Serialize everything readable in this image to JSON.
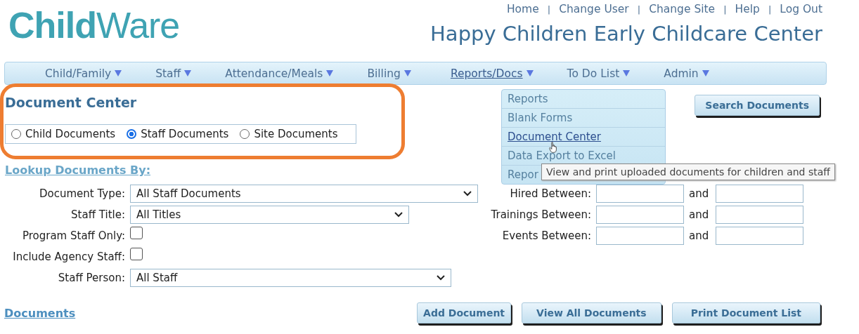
{
  "header": {
    "logo": "**Child**Ware",
    "links": [
      {
        "kind": "link",
        "label": "Home"
      },
      {
        "kind": "separator",
        "label": "|"
      },
      {
        "kind": "link",
        "label": "Change User"
      },
      {
        "kind": "separator",
        "label": "|"
      },
      {
        "kind": "link",
        "label": "Change Site"
      },
      {
        "kind": "separator",
        "label": "|"
      },
      {
        "kind": "link",
        "label": "Help"
      },
      {
        "kind": "separator",
        "label": "|"
      },
      {
        "kind": "link",
        "label": "Log Out"
      }
    ],
    "site_name": "Happy Children Early Childcare Center"
  },
  "nav": [
    {
      "label": "Child/Family",
      "selected": false
    },
    {
      "label": "Staff",
      "selected": false
    },
    {
      "label": "Attendance/Meals",
      "selected": false
    },
    {
      "label": "Billing",
      "selected": false
    },
    {
      "label": "Reports/Docs",
      "selected": true
    },
    {
      "label": "To Do List",
      "selected": false
    },
    {
      "label": "Admin",
      "selected": false
    }
  ],
  "dropdown": [
    {
      "label": "Reports",
      "hovered": false
    },
    {
      "label": "Blank Forms",
      "hovered": false
    },
    {
      "label": "Document Center",
      "hovered": true
    },
    {
      "label": "Data Export to Excel",
      "hovered": false
    },
    {
      "label": "Repor",
      "hovered": false
    }
  ],
  "tooltip": "View and print uploaded documents for children and staff",
  "page_title": "Document Center",
  "search_button": "Search Documents",
  "doc_scope": [
    {
      "label": "Child Documents",
      "selected": false
    },
    {
      "label": "Staff Documents",
      "selected": true
    },
    {
      "label": "Site Documents",
      "selected": false
    }
  ],
  "lookup_heading": "Lookup Documents By:",
  "filters": [
    {
      "kind": "select",
      "label": "Document Type:",
      "value": "All Staff Documents"
    },
    {
      "kind": "select",
      "label": "Staff Title:",
      "value": "All Titles"
    },
    {
      "kind": "checkbox",
      "label": "Program Staff Only:",
      "checked": false
    },
    {
      "kind": "checkbox",
      "label": "Include Agency Staff:",
      "checked": false
    },
    {
      "kind": "select",
      "label": "Staff Person:",
      "value": "All Staff"
    }
  ],
  "date_ranges": [
    {
      "label": "Hired Between:",
      "joiner": "and"
    },
    {
      "label": "Trainings Between:",
      "joiner": "and"
    },
    {
      "label": "Events Between:",
      "joiner": "and"
    }
  ],
  "documents_heading": "Documents",
  "buttons": [
    "Add Document",
    "View All Documents",
    "Print Document List"
  ]
}
